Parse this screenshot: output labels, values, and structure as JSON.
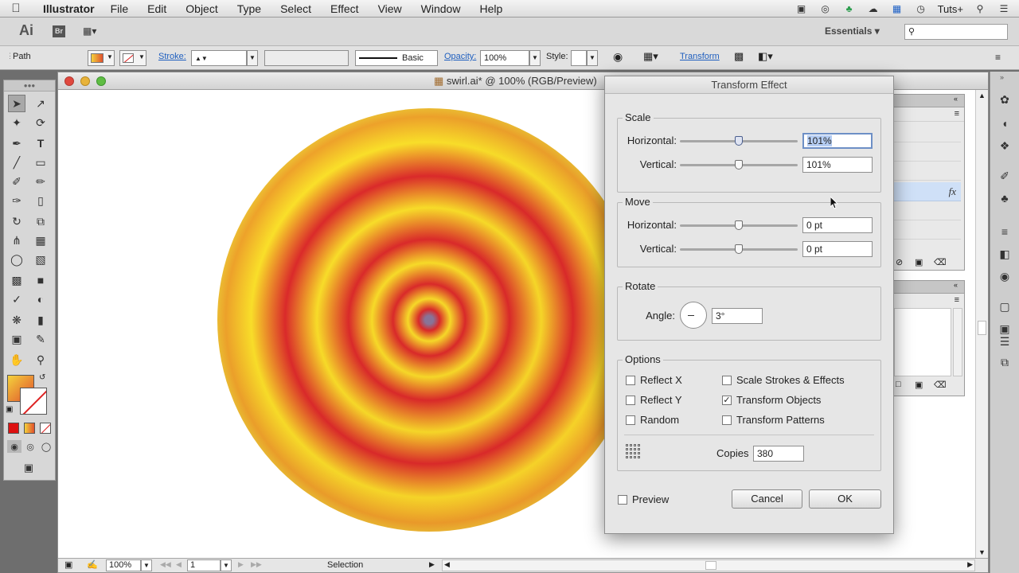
{
  "menubar": {
    "app": "Illustrator",
    "items": [
      "File",
      "Edit",
      "Object",
      "Type",
      "Select",
      "Effect",
      "View",
      "Window",
      "Help"
    ],
    "right_label": "Tuts+"
  },
  "appbar": {
    "app_logo": "Ai",
    "bridge_logo": "Br",
    "workspace": "Essentials",
    "search_placeholder": ""
  },
  "controlbar": {
    "selection_label": "Path",
    "stroke_label": "Stroke:",
    "brush_label": "Basic",
    "opacity_label": "Opacity:",
    "opacity_value": "100%",
    "style_label": "Style:",
    "transform_link": "Transform"
  },
  "document": {
    "title": "swirl.ai* @ 100% (RGB/Preview)",
    "status": {
      "zoom": "100%",
      "artboard": "1",
      "tool": "Selection"
    }
  },
  "colors": {
    "fill_start": "#f4d23c",
    "fill_end": "#e0502c",
    "spiral_red": "#e02b2b",
    "spiral_yellow": "#ffe52a"
  },
  "dialog": {
    "title": "Transform Effect",
    "scale": {
      "label": "Scale",
      "horizontal_label": "Horizontal:",
      "horizontal_value": "101%",
      "vertical_label": "Vertical:",
      "vertical_value": "101%"
    },
    "move": {
      "label": "Move",
      "horizontal_label": "Horizontal:",
      "horizontal_value": "0 pt",
      "vertical_label": "Vertical:",
      "vertical_value": "0 pt"
    },
    "rotate": {
      "label": "Rotate",
      "angle_label": "Angle:",
      "angle_value": "3°"
    },
    "options": {
      "label": "Options",
      "reflect_x": "Reflect X",
      "reflect_y": "Reflect Y",
      "random": "Random",
      "scale_strokes": "Scale Strokes & Effects",
      "transform_objects": "Transform Objects",
      "transform_patterns": "Transform Patterns",
      "copies_label": "Copies",
      "copies_value": "380"
    },
    "preview_label": "Preview",
    "cancel_label": "Cancel",
    "ok_label": "OK"
  },
  "panels": {
    "fx_label": "fx"
  }
}
